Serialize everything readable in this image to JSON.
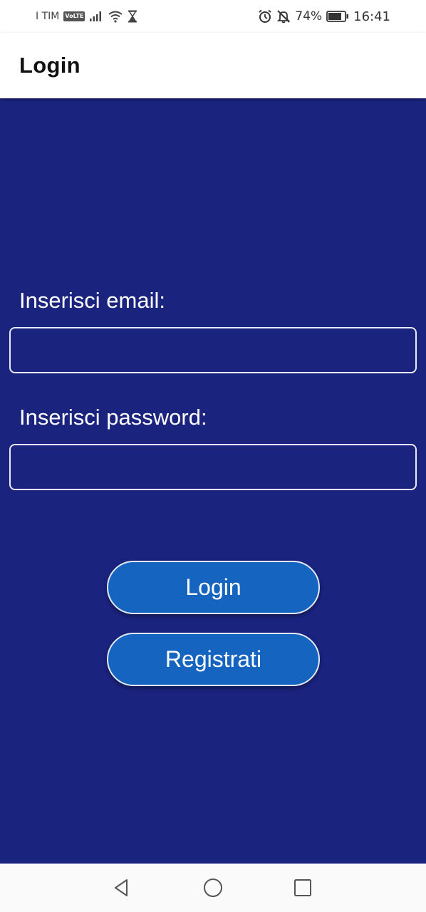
{
  "status_bar": {
    "carrier": "I TIM",
    "volte": "VoLTE",
    "battery": "74%",
    "time": "16:41",
    "icons": [
      "signal-icon",
      "wifi-icon",
      "hourglass-icon",
      "alarm-icon",
      "bell-off-icon",
      "battery-icon"
    ]
  },
  "app_bar": {
    "title": "Login"
  },
  "form": {
    "email_label": "Inserisci email:",
    "email_value": "",
    "password_label": "Inserisci password:",
    "password_value": ""
  },
  "buttons": {
    "login": "Login",
    "register": "Registrati"
  },
  "colors": {
    "background": "#1a237e",
    "button": "#1565c0",
    "app_bar": "#ffffff"
  },
  "nav_bar": {
    "icons": [
      "back-icon",
      "home-icon",
      "recents-icon"
    ]
  }
}
